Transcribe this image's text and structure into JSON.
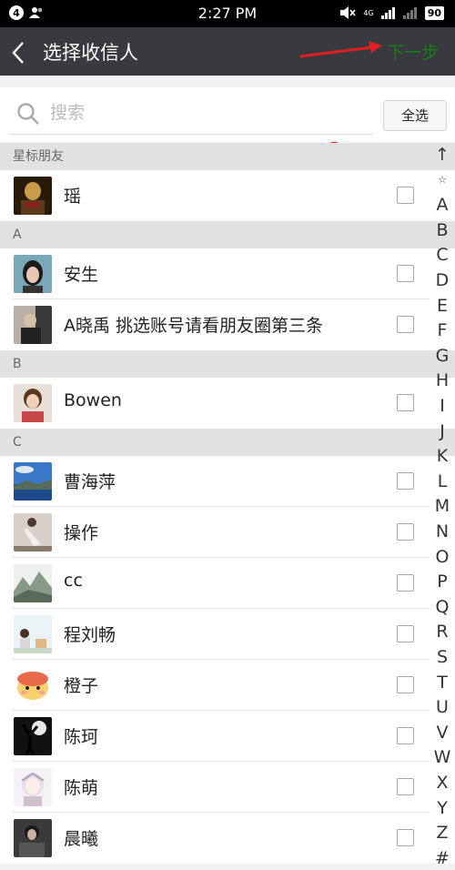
{
  "status_bar": {
    "notification_count": "4",
    "time": "2:27 PM",
    "network": "4G",
    "battery": "90"
  },
  "header": {
    "title": "选择收信人",
    "next_label": "下一步"
  },
  "search": {
    "placeholder": "搜索",
    "value": ""
  },
  "select_all_label": "全选",
  "sections": [
    {
      "title": "星标朋友",
      "contacts": [
        {
          "name": "瑶"
        }
      ]
    },
    {
      "title": "A",
      "contacts": [
        {
          "name": "安生"
        },
        {
          "name": "A晓禹 挑选账号请看朋友圈第三条"
        }
      ]
    },
    {
      "title": "B",
      "contacts": [
        {
          "name": "Bowen"
        }
      ]
    },
    {
      "title": "C",
      "contacts": [
        {
          "name": "曹海萍"
        },
        {
          "name": "操作"
        },
        {
          "name": "cc"
        },
        {
          "name": "程刘畅"
        },
        {
          "name": "橙子"
        },
        {
          "name": "陈珂"
        },
        {
          "name": "陈萌"
        },
        {
          "name": "晨曦"
        }
      ]
    }
  ],
  "index_letters": [
    "↑",
    "☆",
    "A",
    "B",
    "C",
    "D",
    "E",
    "F",
    "G",
    "H",
    "I",
    "J",
    "K",
    "L",
    "M",
    "N",
    "O",
    "P",
    "Q",
    "R",
    "S",
    "T",
    "U",
    "V",
    "W",
    "X",
    "Y",
    "Z",
    "#"
  ],
  "colors": {
    "title_bar": "#393a3f",
    "next_button": "#1a7d1a",
    "annotation_arrow": "#e02020",
    "section_header": "#e2e2e2"
  }
}
